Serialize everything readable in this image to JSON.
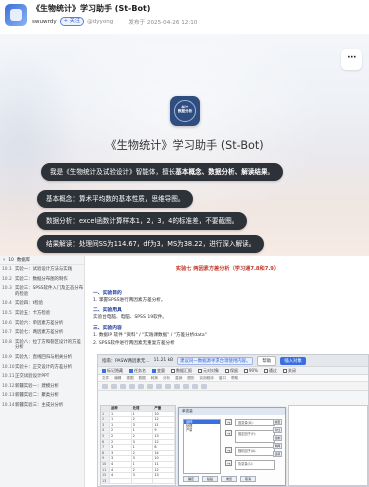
{
  "post": {
    "title": "《生物统计》学习助手 (St-Bot)",
    "author": "swuwrdy",
    "follow_label": "+ 关注",
    "handle": "@dyyong",
    "time": "发布于 2025-04-26 12:10"
  },
  "hero": {
    "more_label": "···",
    "logo_text": "AI+\n数据分析",
    "title": "《生物统计》学习助手 (St-Bot)",
    "intro_prefix": "我是《生物统计及试验设计》智能体，擅长",
    "intro_bold": "基本概念、数据分析、解读结果",
    "intro_suffix": "。",
    "concept": "基本概念：算术平均数的基本性质，思维导图。",
    "analysis": "数据分析：excel函数计算样本1，2，3，4的标准差，不要截图。",
    "result": "结果解读：处理间SS为114.67，df为3，MS为38.22，进行深入解读。"
  },
  "sidebar": {
    "head_num": "10",
    "head_label": "数据库",
    "items": [
      {
        "num": "10.1",
        "text": "实验一：试验设计方法与实践"
      },
      {
        "num": "10.2",
        "text": "实验二：数据分布图的制作"
      },
      {
        "num": "10.3",
        "text": "实验三：SPSS软件入门及正态分布的检验"
      },
      {
        "num": "10.4",
        "text": "实验四：t检验"
      },
      {
        "num": "10.5",
        "text": "实验五：卡方检验"
      },
      {
        "num": "10.6",
        "text": "实验六：单因素方差分析"
      },
      {
        "num": "10.7",
        "text": "实验七：两因素方差分析"
      },
      {
        "num": "10.8",
        "text": "实验八：拉丁方和裂区设计的方差分析"
      },
      {
        "num": "10.9",
        "text": "实验九：直线回归与相关分析"
      },
      {
        "num": "10.10",
        "text": "实验十：正交设计的方差分析"
      },
      {
        "num": "10.11",
        "text": "正交试验设计PPT"
      },
      {
        "num": "10.12",
        "text": "新疆实验一：建模分析"
      },
      {
        "num": "10.13",
        "text": "新疆实验二：聚类分析"
      },
      {
        "num": "10.14",
        "text": "新疆实验三：主成分分析"
      }
    ]
  },
  "doc": {
    "title": "实验七 两因素方差分析（学习通7.8和7.9）",
    "sec1_head": "一、实验目的",
    "sec1_line": "1. 掌握SPSS进行两因素方差分析。",
    "sec2_head": "二、实验用具",
    "sec2_line": "实验台电脑、电脑、SPSS 19软件。",
    "sec3_head": "三、实验内容",
    "sec3_line1": "1. 数据IP 软件 \"资料\" / \"实践课数据\" / \"方差分析data\"",
    "sec3_line2": "2. SPSS软件进行两因素无重复方差分析"
  },
  "spss": {
    "title": "指南：PASW两因素无…",
    "size": "11.21 kB",
    "badge": "建议同一数据源寻求合理使用内容。",
    "btn_help": "帮助",
    "btn_insert": "插入对象",
    "toolbar_items": [
      "标记隐藏",
      "任务名",
      "变量",
      "数据汇报",
      "元对对象",
      "保留",
      "90%",
      "通过",
      "关闭"
    ],
    "menu_items": [
      "文件",
      "编辑",
      "视图",
      "数据",
      "转换",
      "分析",
      "直销",
      "图形",
      "实用程序",
      "窗口",
      "帮助"
    ],
    "grid_head": [
      "",
      "品种",
      "处理",
      "产量"
    ],
    "grid_rows": [
      [
        "1",
        "1",
        "1",
        "10"
      ],
      [
        "2",
        "1",
        "2",
        "12"
      ],
      [
        "3",
        "1",
        "3",
        "11"
      ],
      [
        "4",
        "2",
        "1",
        "9"
      ],
      [
        "5",
        "2",
        "2",
        "13"
      ],
      [
        "6",
        "2",
        "3",
        "12"
      ],
      [
        "7",
        "3",
        "1",
        "8"
      ],
      [
        "8",
        "3",
        "2",
        "14"
      ],
      [
        "9",
        "3",
        "3",
        "10"
      ],
      [
        "10",
        "4",
        "1",
        "11"
      ],
      [
        "11",
        "4",
        "2",
        "12"
      ],
      [
        "12",
        "4",
        "3",
        "13"
      ],
      [
        "13",
        "",
        "",
        ""
      ]
    ],
    "dialog_title": "单变量",
    "dialog_vars": [
      "品种",
      "处理",
      "产量"
    ],
    "dialog_box_labels": [
      "因变量(D):",
      "固定因子(F):",
      "随机因子(A):",
      "协变量(C):"
    ],
    "dialog_side": [
      "模型",
      "对比",
      "绘制",
      "两两",
      "选项"
    ],
    "dialog_footer": [
      "确定",
      "粘贴",
      "重置",
      "取消"
    ]
  }
}
